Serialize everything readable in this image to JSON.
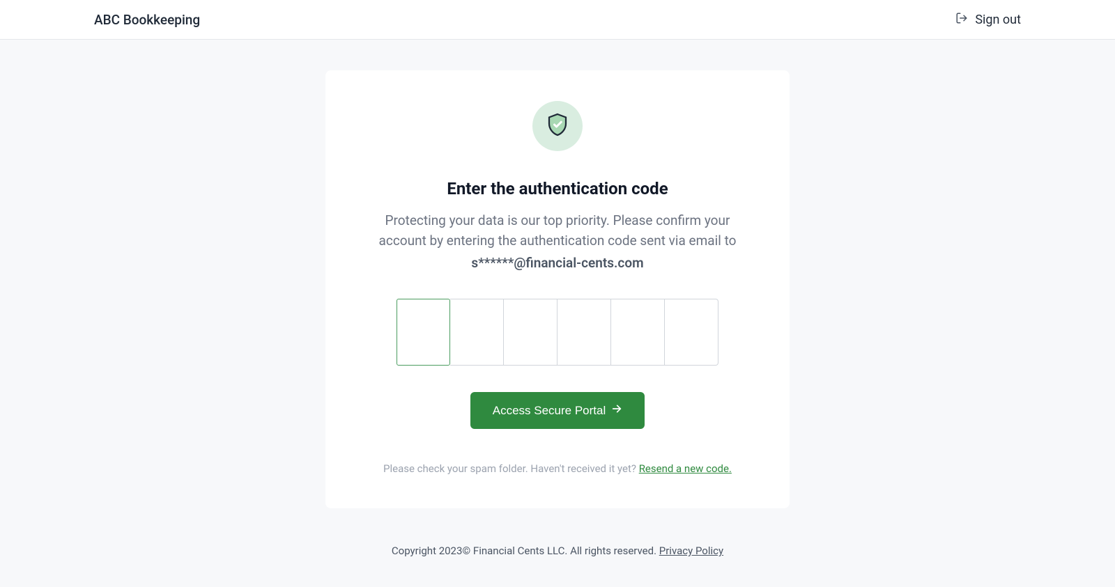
{
  "header": {
    "brand": "ABC Bookkeeping",
    "signout_label": "Sign out"
  },
  "card": {
    "title": "Enter the authentication code",
    "description": "Protecting your data is our top priority. Please confirm your account by entering the authentication code sent via email to",
    "masked_email": "s******@financial-cents.com",
    "submit_label": "Access Secure Portal",
    "helper_text": "Please check your spam folder. Haven't received it yet? ",
    "resend_label": "Resend a new code."
  },
  "footer": {
    "copyright": "Copyright 2023© Financial Cents LLC. All rights reserved. ",
    "privacy_label": "Privacy Policy"
  },
  "colors": {
    "accent": "#2f8a3f",
    "bg": "#f7f8fa",
    "card_bg": "#ffffff",
    "text_muted": "#6b7280"
  }
}
